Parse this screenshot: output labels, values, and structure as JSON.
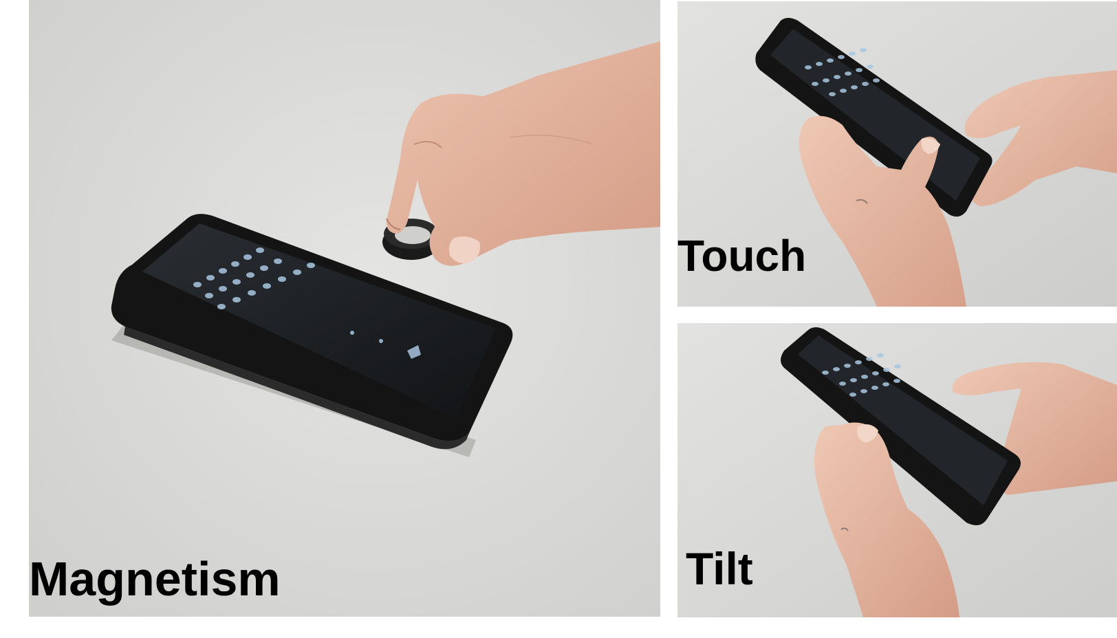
{
  "panels": [
    {
      "label": "Magnetism"
    },
    {
      "label": "Touch"
    },
    {
      "label": "Tilt"
    }
  ],
  "colors": {
    "background": "#ffffff",
    "table_surface": "#d9d9d7",
    "phone_body": "#151515",
    "screen": "#1c1f22",
    "screen_dots": "#a9c6e0",
    "skin": "#e2b6a0",
    "label_text": "#000000"
  }
}
